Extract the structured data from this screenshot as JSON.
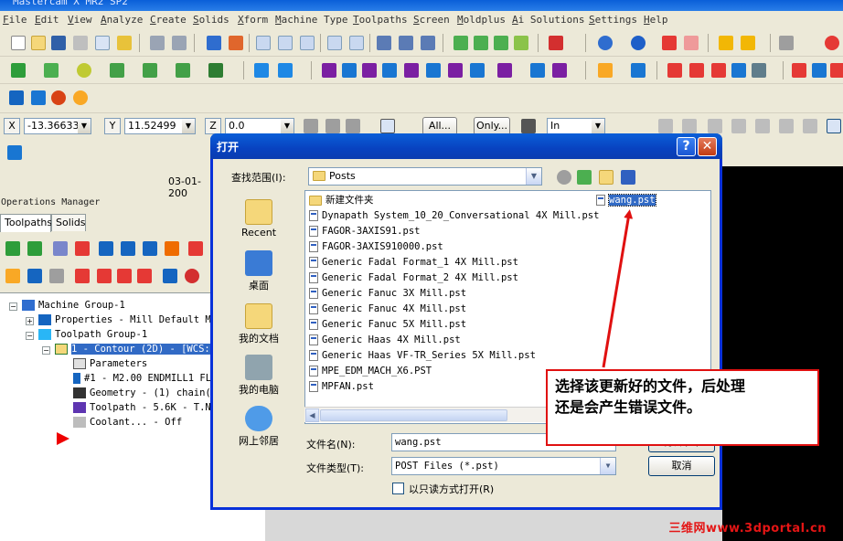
{
  "window": {
    "title": "Mastercam X MR2 SP2"
  },
  "menu": [
    "File",
    "Edit",
    "View",
    "Analyze",
    "Create",
    "Solids",
    "Xform",
    "Machine Type",
    "Toolpaths",
    "Screen",
    "Moldplus",
    "Ai Solutions",
    "Settings",
    "Help"
  ],
  "coords": {
    "x_label": "X",
    "x_value": "-13.36633",
    "y_label": "Y",
    "y_value": "11.52499",
    "z_label": "Z",
    "z_value": "0.0",
    "all_btn": "All...",
    "only_btn": "Only...",
    "units": "In"
  },
  "status_date": "03-01-200",
  "ops": {
    "title": "Operations Manager",
    "tabs": [
      "Toolpaths",
      "Solids"
    ],
    "tree": [
      {
        "label": "Machine Group-1",
        "level": 0
      },
      {
        "label": "Properties - Mill Default MM",
        "level": 1
      },
      {
        "label": "Toolpath Group-1",
        "level": 1
      },
      {
        "label": "1 - Contour (2D) - [WCS:",
        "level": 2
      },
      {
        "label": "Parameters",
        "level": 3
      },
      {
        "label": "#1 - M2.00 ENDMILL1 FL",
        "level": 3
      },
      {
        "label": "Geometry - (1) chain(",
        "level": 3
      },
      {
        "label": "Toolpath - 5.6K - T.N",
        "level": 3
      },
      {
        "label": "Coolant... - Off",
        "level": 3
      }
    ]
  },
  "dialog": {
    "title": "打开",
    "help": "?",
    "close": "✕",
    "lookin_label": "查找范围(I):",
    "lookin_value": "Posts",
    "places": [
      "Recent",
      "桌面",
      "我的文档",
      "我的电脑",
      "网上邻居"
    ],
    "files": [
      "新建文件夹",
      "Dynapath System_10_20_Conversational 4X Mill.pst",
      "FAGOR-3AXIS91.pst",
      "FAGOR-3AXIS910000.pst",
      "Generic Fadal Format_1 4X Mill.pst",
      "Generic Fadal Format_2 4X Mill.pst",
      "Generic Fanuc 3X Mill.pst",
      "Generic Fanuc 4X Mill.pst",
      "Generic Fanuc 5X Mill.pst",
      "Generic Haas 4X Mill.pst",
      "Generic Haas VF-TR_Series 5X Mill.pst",
      "MPE_EDM_MACH_X6.PST",
      "MPFAN.pst"
    ],
    "selected_file": "wang.pst",
    "filename_label": "文件名(N):",
    "filename_value": "wang.pst",
    "filetype_label": "文件类型(T):",
    "filetype_value": "POST Files (*.pst)",
    "open_button": "打开(O)",
    "cancel_button": "取消",
    "readonly_label": "以只读方式打开(R)"
  },
  "callout": {
    "line1": "选择该更新好的文件，后处理",
    "line2": "还是会产生错误文件。"
  },
  "watermark": "三维网www.3dportal.cn"
}
